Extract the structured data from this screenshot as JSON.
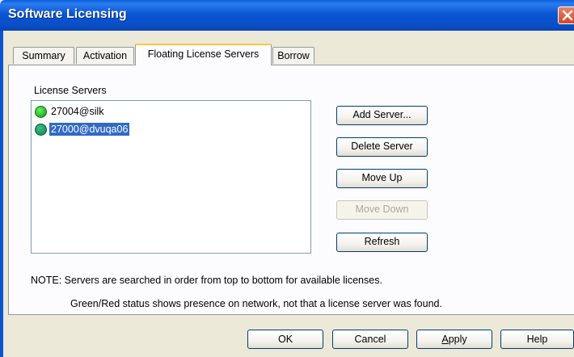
{
  "window": {
    "title": "Software Licensing",
    "close_icon": "close-icon"
  },
  "tabs": [
    {
      "label": "Summary",
      "active": false
    },
    {
      "label": "Activation",
      "active": false
    },
    {
      "label": "Floating License Servers",
      "active": true
    },
    {
      "label": "Borrow",
      "active": false
    }
  ],
  "license_servers": {
    "label": "License Servers",
    "items": [
      {
        "text": "27004@silk",
        "status": "green",
        "selected": false
      },
      {
        "text": "27000@dvuqa06",
        "status": "green",
        "selected": true
      }
    ]
  },
  "side_buttons": {
    "add": "Add Server...",
    "delete": "Delete Server",
    "move_up": "Move Up",
    "move_down": "Move Down",
    "refresh": "Refresh"
  },
  "notes": {
    "line1": "NOTE: Servers are searched in order from top to bottom for available licenses.",
    "line2": "Green/Red status shows presence on network, not that a license server was found."
  },
  "dialog_buttons": {
    "ok": "OK",
    "cancel": "Cancel",
    "apply_prefix": "",
    "apply_mnemonic": "A",
    "apply_rest": "pply",
    "help": "Help"
  },
  "colors": {
    "title_bar": "#0a56d4",
    "selection": "#316ac5",
    "status_green": "#1fb41f",
    "active_tab_accent": "#ffc83c"
  }
}
